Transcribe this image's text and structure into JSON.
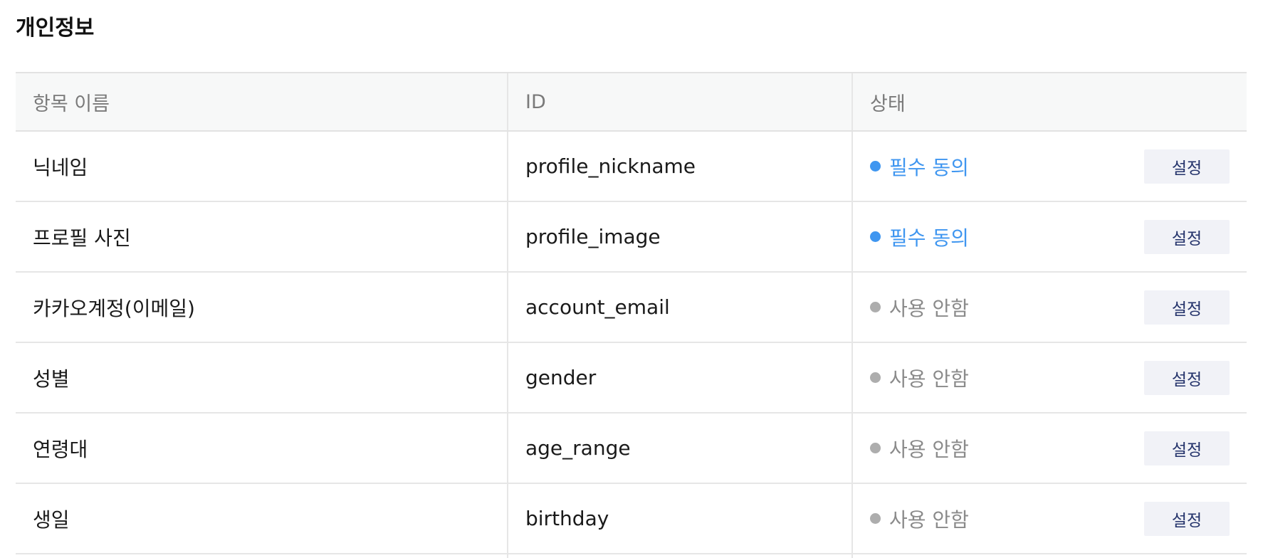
{
  "section": {
    "title": "개인정보"
  },
  "table": {
    "headers": {
      "name": "항목 이름",
      "id": "ID",
      "status": "상태"
    },
    "rows": [
      {
        "name": "닉네임",
        "id": "profile_nickname",
        "status": "필수 동의",
        "status_type": "required",
        "action": "설정"
      },
      {
        "name": "프로필 사진",
        "id": "profile_image",
        "status": "필수 동의",
        "status_type": "required",
        "action": "설정"
      },
      {
        "name": "카카오계정(이메일)",
        "id": "account_email",
        "status": "사용 안함",
        "status_type": "unused",
        "action": "설정"
      },
      {
        "name": "성별",
        "id": "gender",
        "status": "사용 안함",
        "status_type": "unused",
        "action": "설정"
      },
      {
        "name": "연령대",
        "id": "age_range",
        "status": "사용 안함",
        "status_type": "unused",
        "action": "설정"
      },
      {
        "name": "생일",
        "id": "birthday",
        "status": "사용 안함",
        "status_type": "unused",
        "action": "설정"
      }
    ]
  },
  "colors": {
    "required": "#3f96f0",
    "unused": "#adadad",
    "button_bg": "#f1f2f7",
    "button_text": "#24336b",
    "header_bg": "#f7f8f8"
  }
}
